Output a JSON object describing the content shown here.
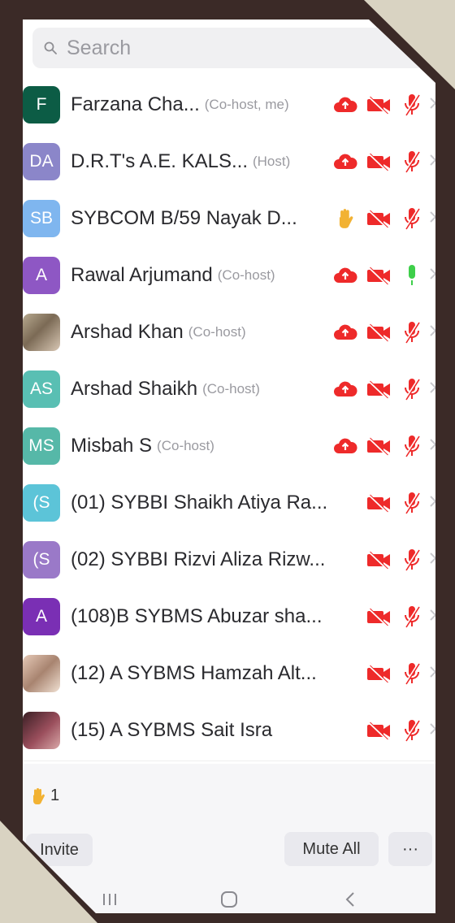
{
  "search": {
    "placeholder": "Search"
  },
  "participants": [
    {
      "initials": "F",
      "avatar_color": "#0c5c45",
      "name": "Farzana Cha...",
      "role": "(Co-host, me)",
      "icons": [
        "cloud-icon",
        "video-off-icon",
        "mic-muted-icon"
      ]
    },
    {
      "initials": "DA",
      "avatar_color": "#8b86c9",
      "name": "D.R.T's A.E. KALS...",
      "role": "(Host)",
      "icons": [
        "cloud-icon",
        "video-off-icon",
        "mic-muted-icon"
      ]
    },
    {
      "initials": "SB",
      "avatar_color": "#7fb6ef",
      "name": "SYBCOM B/59 Nayak D...",
      "role": "",
      "icons": [
        "raised-hand-icon",
        "video-off-icon",
        "mic-muted-icon"
      ]
    },
    {
      "initials": "A",
      "avatar_color": "#8e57c4",
      "name": "Rawal Arjumand",
      "role": "(Co-host)",
      "icons": [
        "cloud-icon",
        "video-off-icon",
        "mic-on-icon"
      ]
    },
    {
      "initials": "",
      "avatar_color": "photo",
      "name": "Arshad Khan",
      "role": "(Co-host)",
      "icons": [
        "cloud-icon",
        "video-off-icon",
        "mic-muted-icon"
      ]
    },
    {
      "initials": "AS",
      "avatar_color": "#59bfb3",
      "name": "Arshad Shaikh",
      "role": "(Co-host)",
      "icons": [
        "cloud-icon",
        "video-off-icon",
        "mic-muted-icon"
      ]
    },
    {
      "initials": "MS",
      "avatar_color": "#56b8a8",
      "name": "Misbah S",
      "role": "(Co-host)",
      "icons": [
        "cloud-icon",
        "video-off-icon",
        "mic-muted-icon"
      ]
    },
    {
      "initials": "(S",
      "avatar_color": "#5cc4d8",
      "name": "(01) SYBBI Shaikh Atiya Ra...",
      "role": "",
      "icons": [
        "video-off-icon",
        "mic-muted-icon"
      ]
    },
    {
      "initials": "(S",
      "avatar_color": "#9a79c8",
      "name": "(02) SYBBI Rizvi Aliza Rizw...",
      "role": "",
      "icons": [
        "video-off-icon",
        "mic-muted-icon"
      ]
    },
    {
      "initials": "A",
      "avatar_color": "#7a2fb4",
      "name": "(108)B SYBMS Abuzar sha...",
      "role": "",
      "icons": [
        "video-off-icon",
        "mic-muted-icon"
      ]
    },
    {
      "initials": "",
      "avatar_color": "photo2",
      "name": "(12) A SYBMS Hamzah Alt...",
      "role": "",
      "icons": [
        "video-off-icon",
        "mic-muted-icon"
      ]
    },
    {
      "initials": "",
      "avatar_color": "photo3",
      "name": "(15) A SYBMS Sait Isra",
      "role": "",
      "icons": [
        "video-off-icon",
        "mic-muted-icon"
      ]
    }
  ],
  "footer": {
    "raised_hands_count": "1",
    "invite_label": "Invite",
    "mute_all_label": "Mute All",
    "more_label": "···"
  },
  "colors": {
    "icon_red": "#ee2a2a",
    "mic_green": "#3ecf4a",
    "hand_yellow": "#f2b233"
  }
}
